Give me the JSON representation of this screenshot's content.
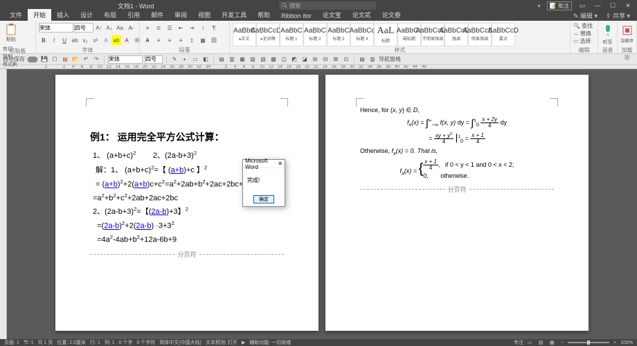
{
  "titlebar": {
    "doc_name": "文档1 - Word",
    "search_placeholder": "搜索",
    "comment_btn": "批注"
  },
  "tabs": {
    "items": [
      "文件",
      "开始",
      "插入",
      "设计",
      "布局",
      "引用",
      "邮件",
      "审阅",
      "视图",
      "开发工具",
      "帮助",
      "Ribbon itor",
      "论文宝",
      "论文贰",
      "论文叁"
    ],
    "active_index": 1,
    "edit_btn": "编辑",
    "share_btn": "共享"
  },
  "ribbon": {
    "clipboard": {
      "paste": "粘贴",
      "cut": "剪切",
      "copy": "复制",
      "brush": "格式刷",
      "label": "剪贴板"
    },
    "font": {
      "name": "宋体",
      "size": "四号",
      "label": "字体"
    },
    "para": {
      "label": "段落"
    },
    "styles": {
      "label": "样式",
      "items": [
        {
          "preview": "AaBbC",
          "name": "▸正文"
        },
        {
          "preview": "AaBbCcDd",
          "name": "▸无间隔"
        },
        {
          "preview": "AaBbC",
          "name": "标题 1"
        },
        {
          "preview": "AaBbC",
          "name": "标题 2"
        },
        {
          "preview": "AaBbC",
          "name": "标题 3"
        },
        {
          "preview": "AaBbCc",
          "name": "标题 4"
        },
        {
          "preview": "AaL",
          "name": "标题"
        },
        {
          "preview": "AaBbCc",
          "name": "副标题"
        },
        {
          "preview": "AaBbCcDd",
          "name": "不明显强调"
        },
        {
          "preview": "AaBbCcDd",
          "name": "强调"
        },
        {
          "preview": "AaBbCcDd",
          "name": "明显强调"
        },
        {
          "preview": "AaBbCcD",
          "name": "要点"
        }
      ]
    },
    "editing": {
      "find": "查找",
      "replace": "替换",
      "select": "选择",
      "label": "编辑"
    },
    "voice": {
      "label": "语音",
      "btn": "听写"
    },
    "addin": {
      "label": "加载项",
      "btn": "加载项"
    }
  },
  "quickrow": {
    "autosave": "自动保存",
    "font": "宋体",
    "size": "四号",
    "nav": "导航窗格"
  },
  "page1": {
    "title": "例1： 运用完全平方公式计算：",
    "l1a": "1、 (a+b+c)",
    "l1b": "2、(2a-b+3)",
    "l2_pre": "解：1、 (a+b+c)",
    "l2_open": "=【 (",
    "l2_ab": "a+b",
    "l2_close": ")+c 】",
    "l3_eq": "=  (",
    "l3_ab1": "a+b",
    "l3_mid": ")",
    "l3_p": "+2(",
    "l3_ab2": "a+b",
    "l3_tail": ")c+c",
    "l3_end": "=a",
    "l3_end2": "+2ab+b",
    "l3_end3": "+2ac+2bc+c",
    "l4": "=a",
    "l4b": "+b",
    "l4c": "+c",
    "l4d": "+2ab+2ac+2bc",
    "l5_pre": "2、(2a-b+3)",
    "l5_open": "=【(",
    "l5_ab": "2a-b",
    "l5_close": ")+3】",
    "l6_eq": "=(",
    "l6_ab1": "2a-b",
    "l6_mid": ")",
    "l6_p": "+2(",
    "l6_ab2": "2a-b",
    "l6_tail": ") ·3+3",
    "l7": "=4a",
    "l7b": "-4ab+b",
    "l7c": "+12a-6b+9",
    "break": "分页符"
  },
  "page2": {
    "l1_pre": "Hence, for (",
    "l1_xy": "x, y",
    "l1_post": ") ∈ ",
    "l1_D": "D",
    "l1_comma": ",",
    "eq1_lhs": "f",
    "eq1_sub": "x",
    "eq1_x": "(x) = ",
    "eq1_int1_dy": " dy = ",
    "eq1_f": "f(x, y)",
    "eq1_frac2_num": "x + 2y",
    "eq1_frac2_den": "4",
    "eq1_dy2": " dy",
    "eq2_num1": "xy + y",
    "eq2_den": "4",
    "eq2_bar": "1",
    "eq2_bar0": "0",
    "eq2_eq": " = ",
    "eq2_num2": "x + 1",
    "eq2_den2": "4",
    "l2_pre": "Otherwise, ",
    "l2_fx": "f",
    "l2_sub": "x",
    "l2_x": "(x) = 0.  That is,",
    "case_lhs": "f",
    "case_sub": "x",
    "case_x": "(x) = ",
    "case1_num": "x + 1",
    "case1_den": "4",
    "case1_cond": "if 0 < y < 1 and 0 < x < 2;",
    "case2_val": "0,",
    "case2_cond": "otherwise.",
    "break": "分页符"
  },
  "dialog": {
    "title": "Microsoft Word",
    "body": "完成!",
    "ok": "确定"
  },
  "status": {
    "page": "页面: 1",
    "sec": "节: 1",
    "pages": "共 1 页",
    "pos": "位置: 2.5厘米",
    "line": "行: 1",
    "col": "列: 1",
    "words": "0 个字",
    "chars_nospc": "0 个字符",
    "lang": "简体中文(中国大陆)",
    "track": "文本预测: 打开",
    "assist": "辅助功能: 一切就绪",
    "focus": "专注",
    "zoom": "100%"
  }
}
